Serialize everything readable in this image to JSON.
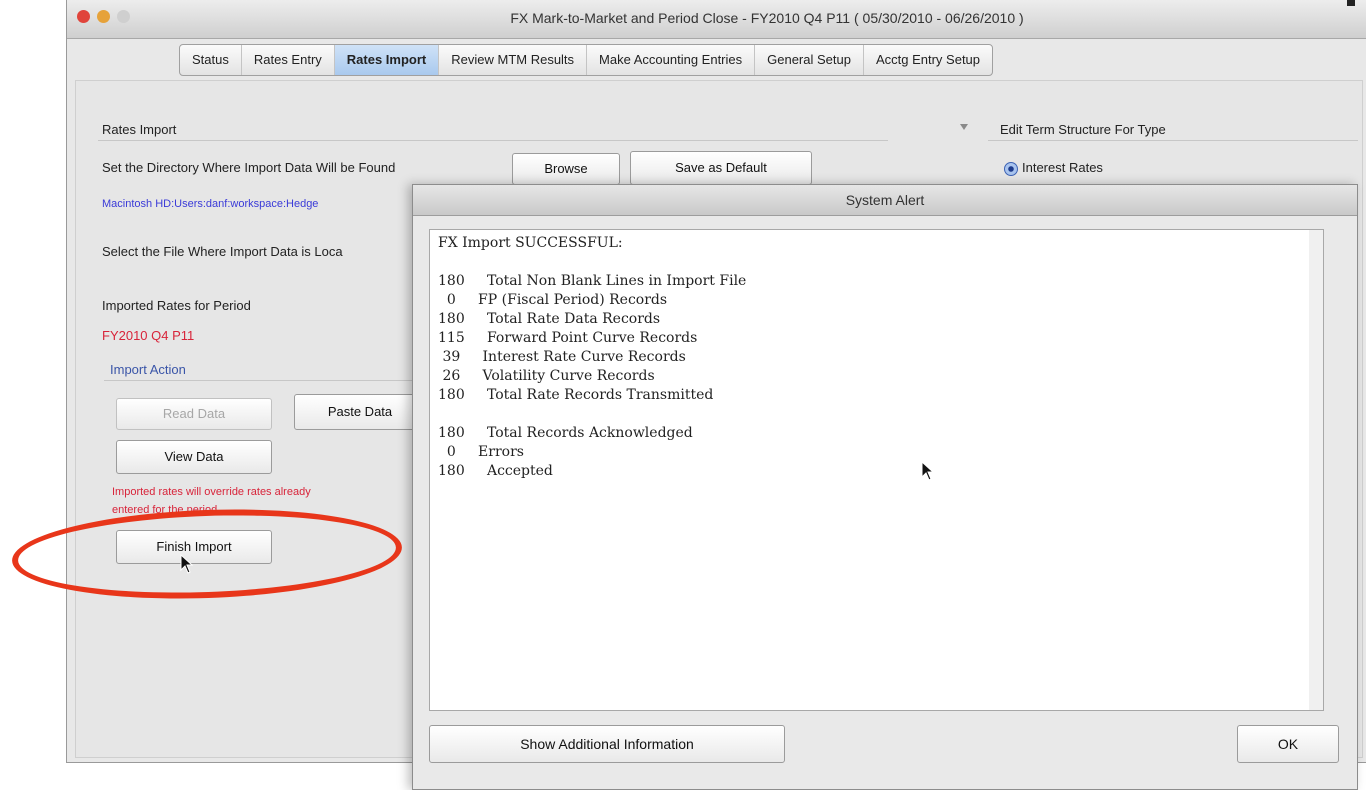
{
  "window": {
    "title": "FX Mark-to-Market and Period Close - FY2010 Q4 P11  ( 05/30/2010 - 06/26/2010 )"
  },
  "tabs": [
    {
      "label": "Status"
    },
    {
      "label": "Rates Entry"
    },
    {
      "label": "Rates Import",
      "active": true
    },
    {
      "label": "Review MTM Results"
    },
    {
      "label": "Make Accounting Entries"
    },
    {
      "label": "General Setup"
    },
    {
      "label": "Acctg Entry Setup"
    }
  ],
  "rates_import": {
    "section_title": "Rates Import",
    "directory_label": "Set the Directory Where Import Data Will be Found",
    "browse_button": "Browse",
    "save_default_button": "Save as Default",
    "directory_path": "Macintosh HD:Users:danf:workspace:Hedge",
    "file_label": "Select the File Where Import Data is Loca",
    "imported_rates_label": "Imported Rates for Period",
    "period_value": "FY2010 Q4 P11",
    "import_action_title": "Import Action",
    "read_data_button": "Read Data",
    "paste_data_button": "Paste Data",
    "view_data_button": "View Data",
    "override_warning_1": "Imported rates will override rates already",
    "override_warning_2": "entered for the period.",
    "finish_import_button": "Finish Import"
  },
  "term_structure": {
    "title": "Edit Term Structure For Type",
    "option_interest_rates": "Interest Rates"
  },
  "dialog": {
    "title": "System Alert",
    "message": "FX Import SUCCESSFUL:\n\n180     Total Non Blank Lines in Import File\n  0     FP (Fiscal Period) Records\n180     Total Rate Data Records\n115     Forward Point Curve Records\n 39     Interest Rate Curve Records\n 26     Volatility Curve Records\n180     Total Rate Records Transmitted\n\n180     Total Records Acknowledged\n  0     Errors\n180     Accepted",
    "show_info_button": "Show Additional Information",
    "ok_button": "OK"
  },
  "colors": {
    "highlight_oval": "#e8361a",
    "path_text": "#3a3ad8",
    "period_text": "#d8243a",
    "section_title": "#3a55a8"
  }
}
